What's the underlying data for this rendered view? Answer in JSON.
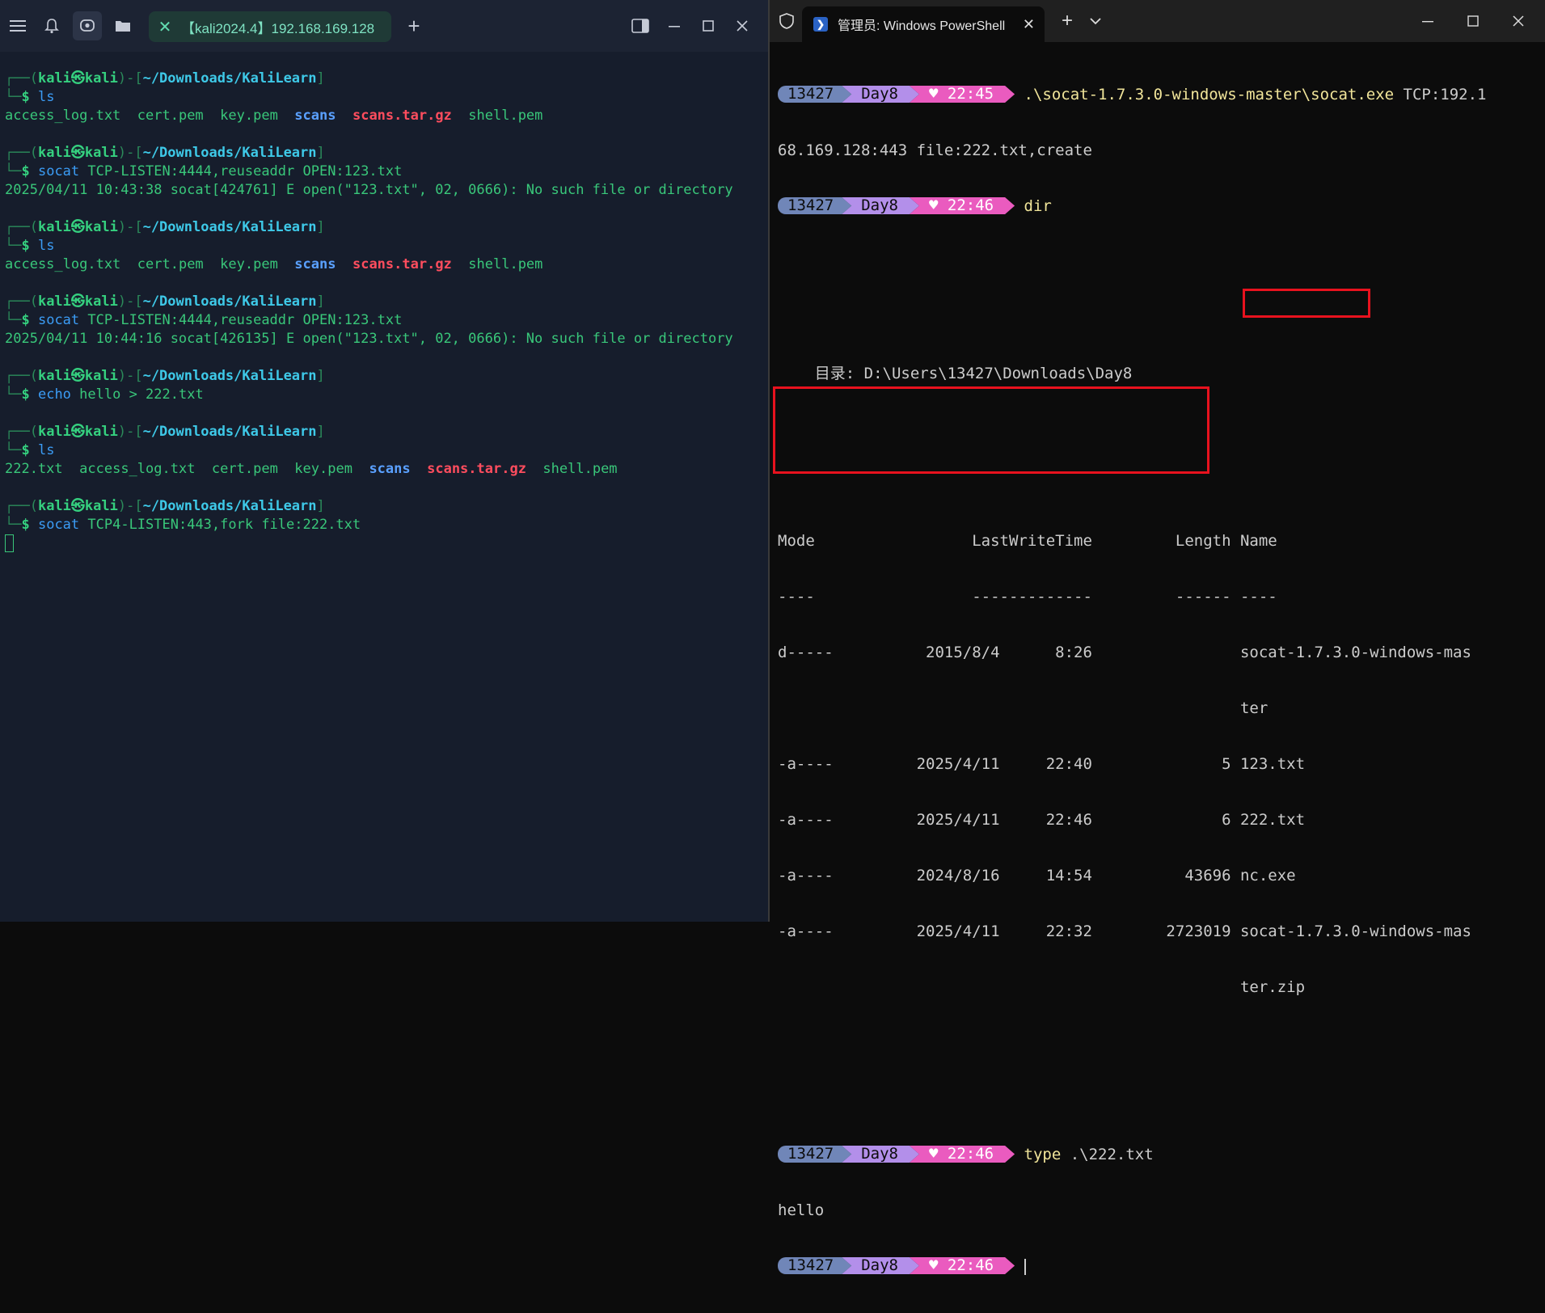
{
  "kali": {
    "tab_title": "【kali2024.4】192.168.169.128",
    "prompt": {
      "user": "kali",
      "at": "㉿",
      "host": "kali",
      "path": "~/Downloads/KaliLearn"
    },
    "blocks": [
      {
        "cmd": "ls",
        "args": "",
        "output": [
          {
            "type": "ls",
            "items": [
              {
                "t": "access_log.txt",
                "k": "plain"
              },
              {
                "t": "cert.pem",
                "k": "plain"
              },
              {
                "t": "key.pem",
                "k": "plain"
              },
              {
                "t": "scans",
                "k": "dir"
              },
              {
                "t": "scans.tar.gz",
                "k": "arch"
              },
              {
                "t": "shell.pem",
                "k": "plain"
              }
            ]
          }
        ]
      },
      {
        "cmd": "socat",
        "args": " TCP-LISTEN:4444,reuseaddr OPEN:123.txt",
        "output": [
          {
            "type": "text",
            "t": "2025/04/11 10:43:38 socat[424761] E open(\"123.txt\", 02, 0666): No such file or directory"
          }
        ]
      },
      {
        "cmd": "ls",
        "args": "",
        "output": [
          {
            "type": "ls",
            "items": [
              {
                "t": "access_log.txt",
                "k": "plain"
              },
              {
                "t": "cert.pem",
                "k": "plain"
              },
              {
                "t": "key.pem",
                "k": "plain"
              },
              {
                "t": "scans",
                "k": "dir"
              },
              {
                "t": "scans.tar.gz",
                "k": "arch"
              },
              {
                "t": "shell.pem",
                "k": "plain"
              }
            ]
          }
        ]
      },
      {
        "cmd": "socat",
        "args": " TCP-LISTEN:4444,reuseaddr OPEN:123.txt",
        "output": [
          {
            "type": "text",
            "t": "2025/04/11 10:44:16 socat[426135] E open(\"123.txt\", 02, 0666): No such file or directory"
          }
        ]
      },
      {
        "cmd": "echo",
        "args": " hello > 222.txt",
        "output": []
      },
      {
        "cmd": "ls",
        "args": "",
        "output": [
          {
            "type": "ls",
            "items": [
              {
                "t": "222.txt",
                "k": "plain"
              },
              {
                "t": "access_log.txt",
                "k": "plain"
              },
              {
                "t": "cert.pem",
                "k": "plain"
              },
              {
                "t": "key.pem",
                "k": "plain"
              },
              {
                "t": "scans",
                "k": "dir"
              },
              {
                "t": "scans.tar.gz",
                "k": "arch"
              },
              {
                "t": "shell.pem",
                "k": "plain"
              }
            ]
          }
        ]
      },
      {
        "cmd": "socat",
        "args": " TCP4-LISTEN:443,fork file:222.txt",
        "output": [],
        "cursor": true
      }
    ]
  },
  "pwsh": {
    "tab_title": "管理员: Windows PowerShell",
    "prompt": {
      "user": "13427",
      "dir": "Day8",
      "heart": "♥"
    },
    "cmd1": {
      "time": "22:45",
      "cmd": ".\\socat-1.7.3.0-windows-master\\socat.exe",
      "args": " TCP:192.1",
      "wrap": "68.169.128:443 file:222.txt,create"
    },
    "cmd2": {
      "time": "22:46",
      "cmd": "dir"
    },
    "dir_header": "    目录: D:\\Users\\13427\\Downloads\\Day8",
    "table_header": "Mode                 LastWriteTime         Length Name",
    "table_rule": "----                 -------------         ------ ----",
    "rows": [
      "d-----          2015/8/4      8:26                socat-1.7.3.0-windows-mas",
      "                                                  ter",
      "-a----         2025/4/11     22:40              5 123.txt",
      "-a----         2025/4/11     22:46              6 222.txt",
      "-a----         2024/8/16     14:54          43696 nc.exe",
      "-a----         2025/4/11     22:32        2723019 socat-1.7.3.0-windows-mas",
      "                                                  ter.zip"
    ],
    "cmd3": {
      "time": "22:46",
      "cmd": "type",
      "args": " .\\222.txt"
    },
    "type_output": "hello",
    "cmd4": {
      "time": "22:46"
    }
  }
}
